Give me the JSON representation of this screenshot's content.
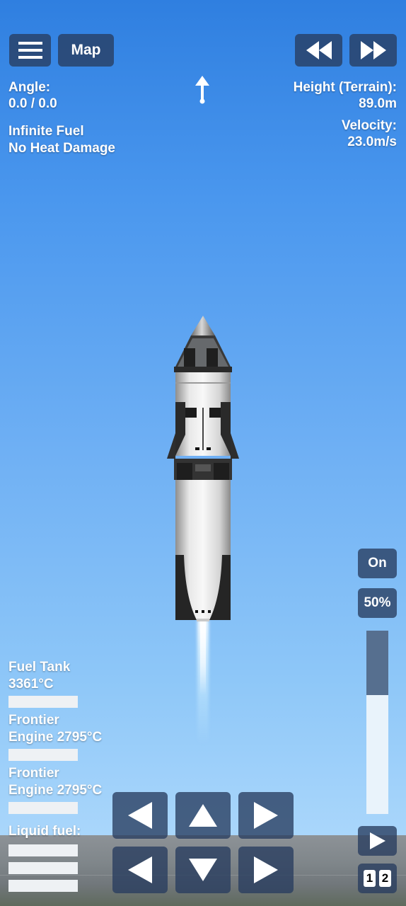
{
  "top_bar": {
    "menu_label": "menu",
    "map_label": "Map",
    "rewind_label": "rewind",
    "fast_forward_label": "fast forward"
  },
  "telemetry": {
    "angle_label": "Angle:",
    "angle_value": "0.0 / 0.0",
    "height_label": "Height (Terrain):",
    "height_value": "89.0m",
    "velocity_label": "Velocity:",
    "velocity_value": "23.0m/s"
  },
  "cheats": {
    "line1": "Infinite Fuel",
    "line2": "No Heat Damage"
  },
  "parts": [
    {
      "line1": "Fuel Tank",
      "line2": "3361°C"
    },
    {
      "line1": "Frontier",
      "line2": "Engine 2795°C"
    },
    {
      "line1": "Frontier",
      "line2": "Engine 2795°C"
    }
  ],
  "liquid_fuel_label": "Liquid fuel:",
  "throttle": {
    "toggle_label": "On",
    "percent_label": "50%",
    "level": 0.35
  },
  "stage_labels": [
    "1",
    "2"
  ],
  "icons": {
    "menu": "hamburger-icon",
    "rewind": "rewind-icon",
    "fast_forward": "fast-forward-icon",
    "heading": "heading-arrow-icon",
    "play": "play-icon"
  }
}
